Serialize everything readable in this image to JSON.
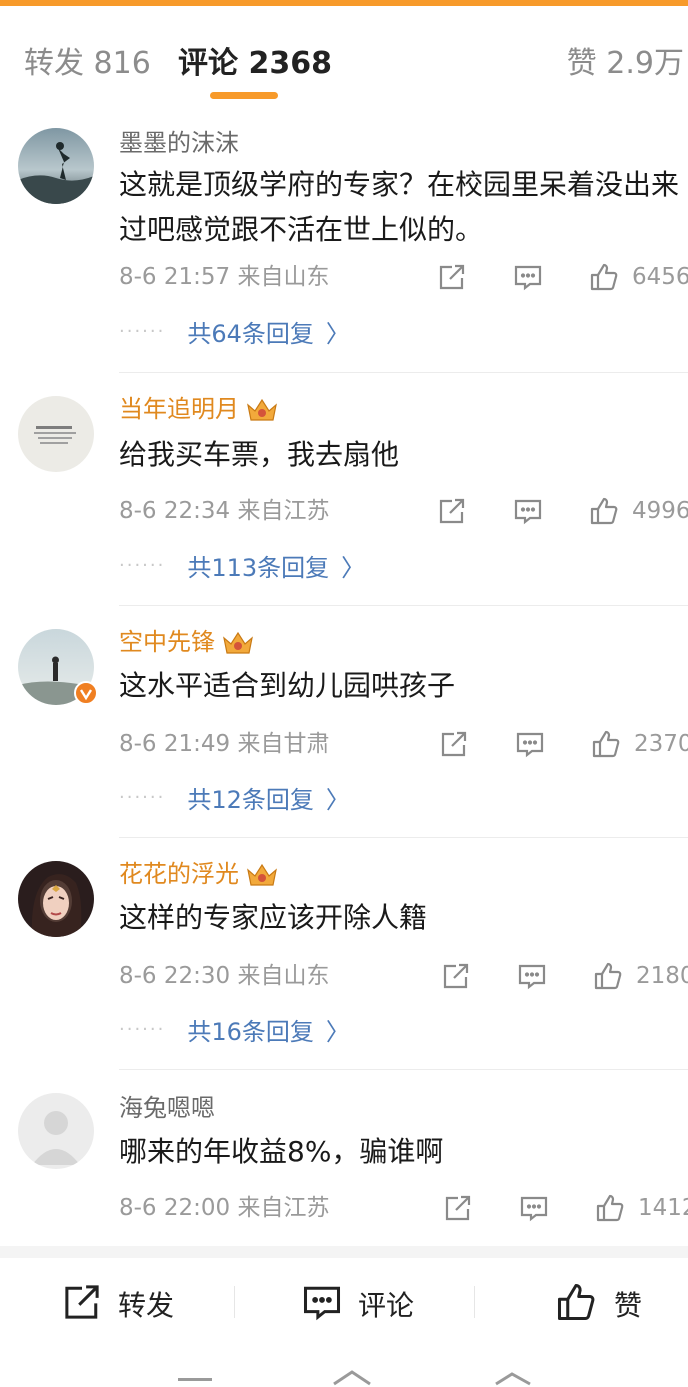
{
  "tabs": {
    "repost": "转发 816",
    "comment": "评论 2368",
    "like": "赞 2.9万"
  },
  "colors": {
    "accent": "#f79a2a",
    "vip_name": "#e0891f",
    "link": "#4c7ab8"
  },
  "comments": [
    {
      "username": "墨墨的沫沫",
      "vip": false,
      "text": "这就是顶级学府的专家？在校园里呆着没出来过吧感觉跟不活在世上似的。",
      "meta": "8-6 21:57  来自山东",
      "likes": "6456",
      "replies": "共64条回复"
    },
    {
      "username": "当年追明月",
      "vip": true,
      "text": "给我买车票，我去扇他",
      "meta": "8-6 22:34  来自江苏",
      "likes": "4996",
      "replies": "共113条回复"
    },
    {
      "username": "空中先锋",
      "vip": true,
      "verified": true,
      "text": "这水平适合到幼儿园哄孩子",
      "meta": "8-6 21:49  来自甘肃",
      "likes": "2370",
      "replies": "共12条回复"
    },
    {
      "username": "花花的浮光",
      "vip": true,
      "text": "这样的专家应该开除人籍",
      "meta": "8-6 22:30  来自山东",
      "likes": "2180",
      "replies": "共16条回复"
    },
    {
      "username": "海兔嗯嗯",
      "vip": false,
      "text": "哪来的年收益8%，骗谁啊",
      "meta": "8-6 22:00  来自江苏",
      "likes": "1412",
      "replies": ""
    }
  ],
  "icons": {
    "share": "share-icon",
    "comment": "comment-icon",
    "like": "thumbs-up-icon",
    "crown": "crown-badge-icon",
    "verified": "verified-badge-icon",
    "chevron": "chevron-right-icon"
  },
  "bottom_bar": {
    "repost": "转发",
    "comment": "评论",
    "like": "赞"
  },
  "reply_dots": "······",
  "reply_chevron": "〉"
}
